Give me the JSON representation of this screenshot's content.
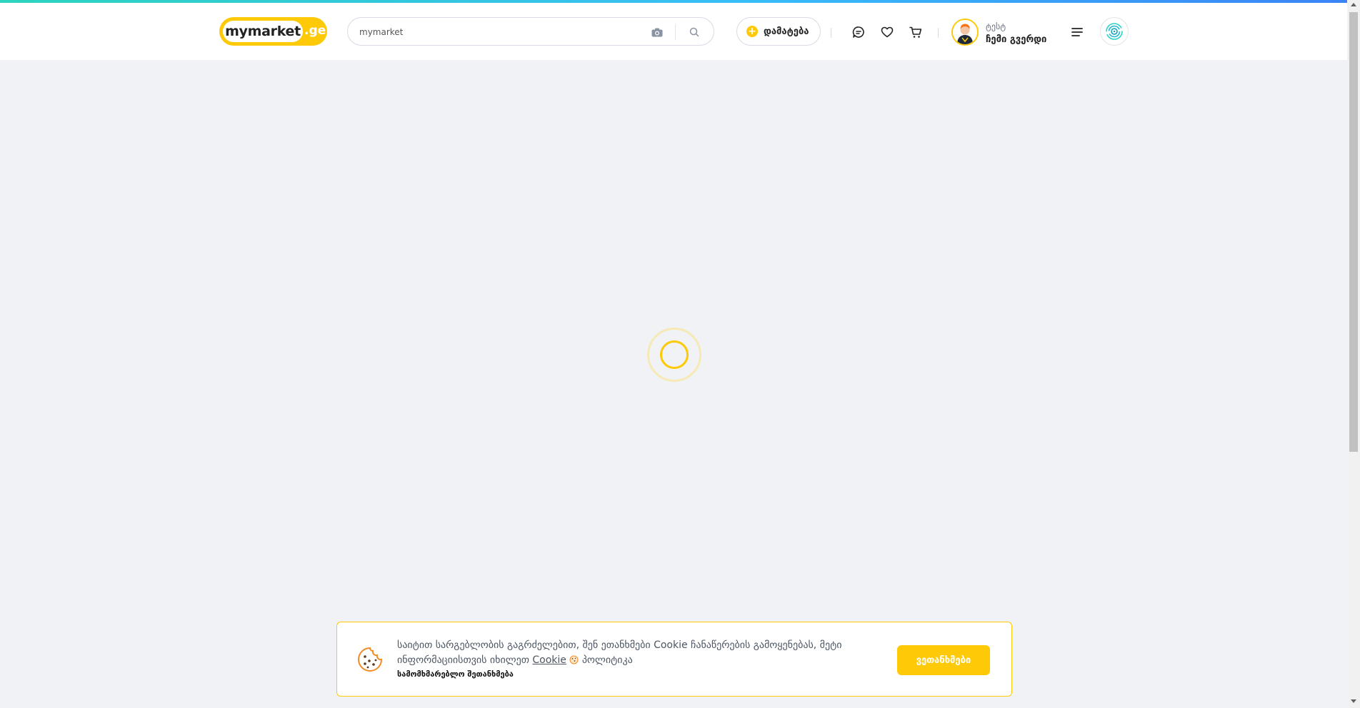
{
  "header": {
    "logo_main": "mymarket",
    "logo_suffix": ".ge",
    "search": {
      "value": "mymarket",
      "placeholder": ""
    },
    "add_label": "დამატება",
    "profile": {
      "name": "ტესტ",
      "page_label": "ჩემი გვერდი"
    }
  },
  "cookie": {
    "text_before": "საიტით სარგებლობის გაგრძელებით, შენ ეთანხმები Cookie ჩანაწერების გამოყენებას, მეტი ინფორმაციისთვის იხილეთ",
    "link_label": "Cookie",
    "text_after": "პოლიტიკა",
    "terms_label": "სამომხმარებლო შეთანხმება",
    "accept_label": "ვეთანხმები"
  },
  "colors": {
    "accent": "#fec907",
    "background": "#f1f2f6",
    "top_strip_start": "#2dd4bf",
    "top_strip_end": "#3b82f6"
  },
  "icons": [
    "camera-icon",
    "search-icon",
    "plus-icon",
    "chat-icon",
    "heart-icon",
    "cart-icon",
    "hamburger-menu-icon",
    "brand-fingerprint-icon",
    "cookie-icon",
    "loading-spinner"
  ]
}
